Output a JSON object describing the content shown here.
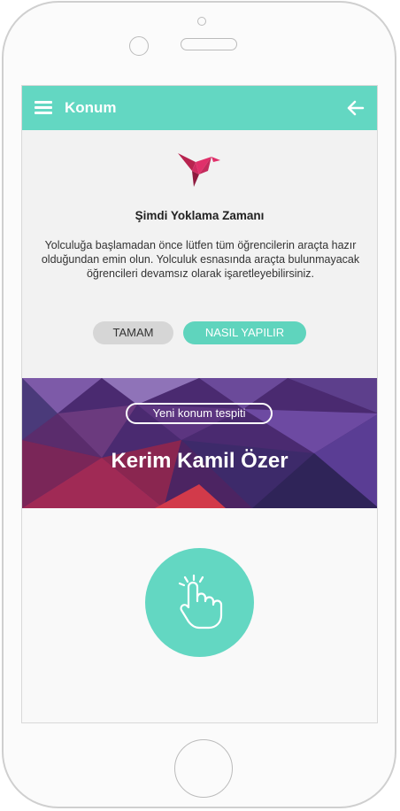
{
  "appbar": {
    "title": "Konum",
    "menu_icon": "hamburger-menu-icon",
    "back_icon": "arrow-left-icon"
  },
  "intro": {
    "logo_icon": "bird-logo-icon",
    "headline": "Şimdi Yoklama Zamanı",
    "body": "Yolculuğa başlamadan önce lütfen tüm öğrencilerin araçta hazır olduğundan emin olun. Yolculuk esnasında araçta bulunmayacak öğrencileri devamsız olarak işaretleyebilirsiniz.",
    "ok_label": "TAMAM",
    "how_label": "NASIL YAPILIR"
  },
  "banner": {
    "badge": "Yeni konum tespiti",
    "name": "Kerim Kamil Özer"
  },
  "action": {
    "icon": "tap-hand-icon"
  },
  "colors": {
    "accent": "#63d7c2",
    "banner_purple": "#5a2d82",
    "logo_pink": "#e0306a"
  }
}
